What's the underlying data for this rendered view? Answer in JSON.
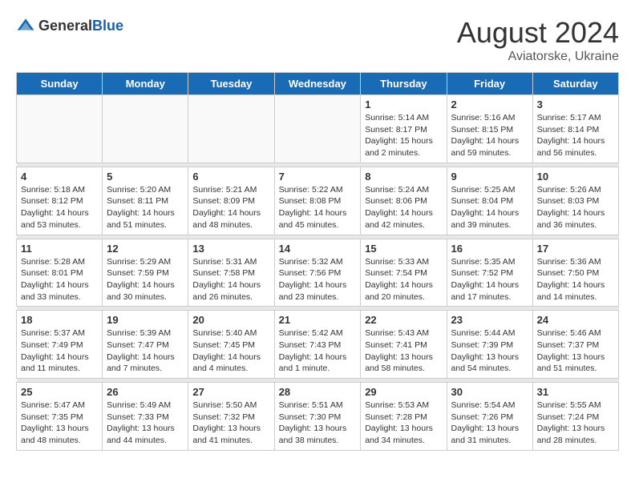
{
  "logo": {
    "general": "General",
    "blue": "Blue"
  },
  "header": {
    "month": "August 2024",
    "location": "Aviatorske, Ukraine"
  },
  "weekdays": [
    "Sunday",
    "Monday",
    "Tuesday",
    "Wednesday",
    "Thursday",
    "Friday",
    "Saturday"
  ],
  "weeks": [
    [
      {
        "day": "",
        "info": ""
      },
      {
        "day": "",
        "info": ""
      },
      {
        "day": "",
        "info": ""
      },
      {
        "day": "",
        "info": ""
      },
      {
        "day": "1",
        "info": "Sunrise: 5:14 AM\nSunset: 8:17 PM\nDaylight: 15 hours\nand 2 minutes."
      },
      {
        "day": "2",
        "info": "Sunrise: 5:16 AM\nSunset: 8:15 PM\nDaylight: 14 hours\nand 59 minutes."
      },
      {
        "day": "3",
        "info": "Sunrise: 5:17 AM\nSunset: 8:14 PM\nDaylight: 14 hours\nand 56 minutes."
      }
    ],
    [
      {
        "day": "4",
        "info": "Sunrise: 5:18 AM\nSunset: 8:12 PM\nDaylight: 14 hours\nand 53 minutes."
      },
      {
        "day": "5",
        "info": "Sunrise: 5:20 AM\nSunset: 8:11 PM\nDaylight: 14 hours\nand 51 minutes."
      },
      {
        "day": "6",
        "info": "Sunrise: 5:21 AM\nSunset: 8:09 PM\nDaylight: 14 hours\nand 48 minutes."
      },
      {
        "day": "7",
        "info": "Sunrise: 5:22 AM\nSunset: 8:08 PM\nDaylight: 14 hours\nand 45 minutes."
      },
      {
        "day": "8",
        "info": "Sunrise: 5:24 AM\nSunset: 8:06 PM\nDaylight: 14 hours\nand 42 minutes."
      },
      {
        "day": "9",
        "info": "Sunrise: 5:25 AM\nSunset: 8:04 PM\nDaylight: 14 hours\nand 39 minutes."
      },
      {
        "day": "10",
        "info": "Sunrise: 5:26 AM\nSunset: 8:03 PM\nDaylight: 14 hours\nand 36 minutes."
      }
    ],
    [
      {
        "day": "11",
        "info": "Sunrise: 5:28 AM\nSunset: 8:01 PM\nDaylight: 14 hours\nand 33 minutes."
      },
      {
        "day": "12",
        "info": "Sunrise: 5:29 AM\nSunset: 7:59 PM\nDaylight: 14 hours\nand 30 minutes."
      },
      {
        "day": "13",
        "info": "Sunrise: 5:31 AM\nSunset: 7:58 PM\nDaylight: 14 hours\nand 26 minutes."
      },
      {
        "day": "14",
        "info": "Sunrise: 5:32 AM\nSunset: 7:56 PM\nDaylight: 14 hours\nand 23 minutes."
      },
      {
        "day": "15",
        "info": "Sunrise: 5:33 AM\nSunset: 7:54 PM\nDaylight: 14 hours\nand 20 minutes."
      },
      {
        "day": "16",
        "info": "Sunrise: 5:35 AM\nSunset: 7:52 PM\nDaylight: 14 hours\nand 17 minutes."
      },
      {
        "day": "17",
        "info": "Sunrise: 5:36 AM\nSunset: 7:50 PM\nDaylight: 14 hours\nand 14 minutes."
      }
    ],
    [
      {
        "day": "18",
        "info": "Sunrise: 5:37 AM\nSunset: 7:49 PM\nDaylight: 14 hours\nand 11 minutes."
      },
      {
        "day": "19",
        "info": "Sunrise: 5:39 AM\nSunset: 7:47 PM\nDaylight: 14 hours\nand 7 minutes."
      },
      {
        "day": "20",
        "info": "Sunrise: 5:40 AM\nSunset: 7:45 PM\nDaylight: 14 hours\nand 4 minutes."
      },
      {
        "day": "21",
        "info": "Sunrise: 5:42 AM\nSunset: 7:43 PM\nDaylight: 14 hours\nand 1 minute."
      },
      {
        "day": "22",
        "info": "Sunrise: 5:43 AM\nSunset: 7:41 PM\nDaylight: 13 hours\nand 58 minutes."
      },
      {
        "day": "23",
        "info": "Sunrise: 5:44 AM\nSunset: 7:39 PM\nDaylight: 13 hours\nand 54 minutes."
      },
      {
        "day": "24",
        "info": "Sunrise: 5:46 AM\nSunset: 7:37 PM\nDaylight: 13 hours\nand 51 minutes."
      }
    ],
    [
      {
        "day": "25",
        "info": "Sunrise: 5:47 AM\nSunset: 7:35 PM\nDaylight: 13 hours\nand 48 minutes."
      },
      {
        "day": "26",
        "info": "Sunrise: 5:49 AM\nSunset: 7:33 PM\nDaylight: 13 hours\nand 44 minutes."
      },
      {
        "day": "27",
        "info": "Sunrise: 5:50 AM\nSunset: 7:32 PM\nDaylight: 13 hours\nand 41 minutes."
      },
      {
        "day": "28",
        "info": "Sunrise: 5:51 AM\nSunset: 7:30 PM\nDaylight: 13 hours\nand 38 minutes."
      },
      {
        "day": "29",
        "info": "Sunrise: 5:53 AM\nSunset: 7:28 PM\nDaylight: 13 hours\nand 34 minutes."
      },
      {
        "day": "30",
        "info": "Sunrise: 5:54 AM\nSunset: 7:26 PM\nDaylight: 13 hours\nand 31 minutes."
      },
      {
        "day": "31",
        "info": "Sunrise: 5:55 AM\nSunset: 7:24 PM\nDaylight: 13 hours\nand 28 minutes."
      }
    ]
  ]
}
